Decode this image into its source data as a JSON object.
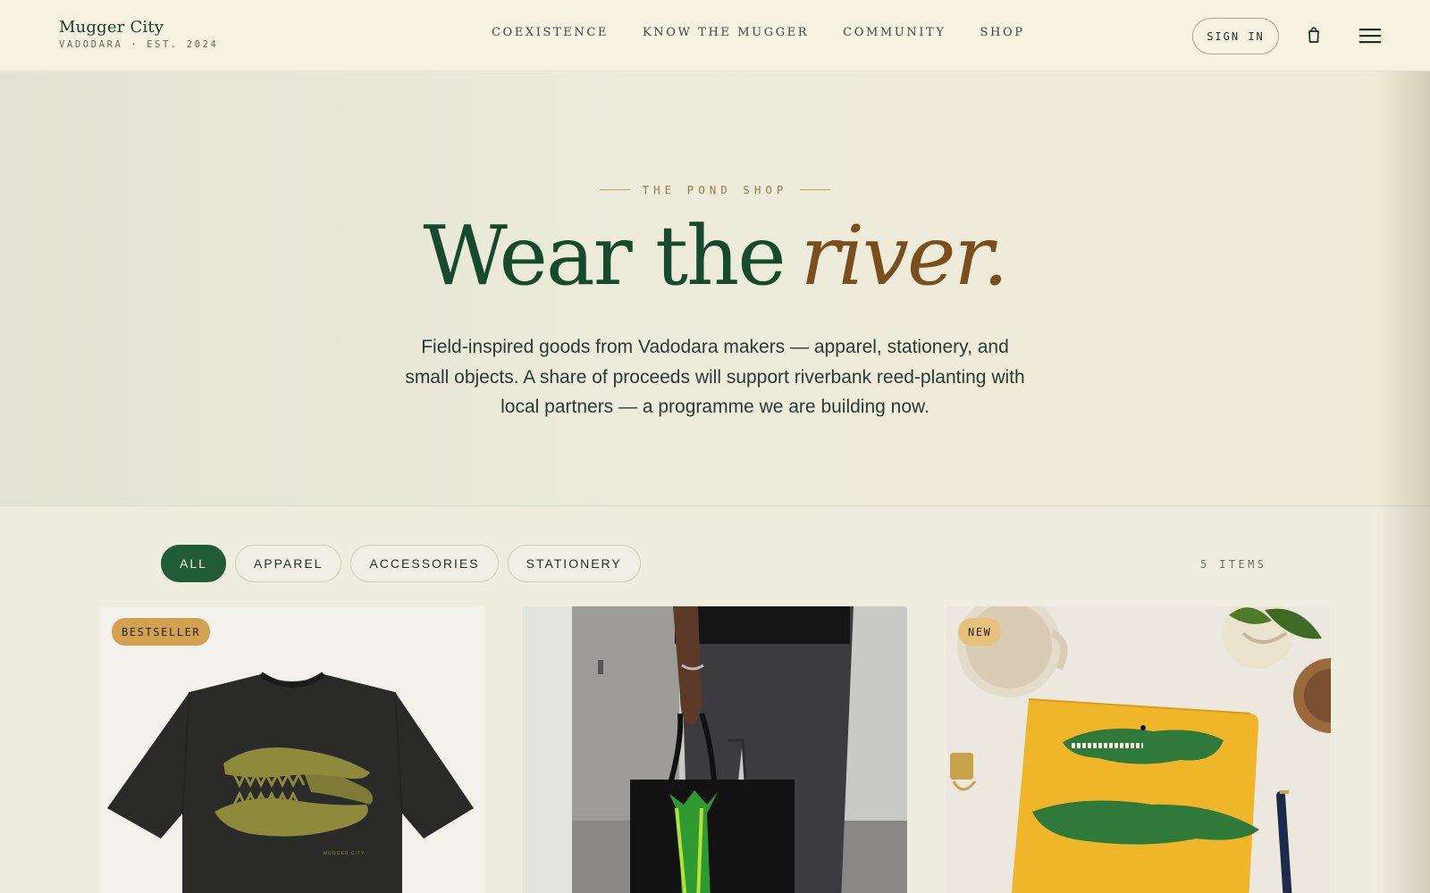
{
  "header": {
    "brand_name": "Mugger City",
    "brand_sub": "VADODARA · EST. 2024",
    "nav": [
      "COEXISTENCE",
      "KNOW THE MUGGER",
      "COMMUNITY",
      "SHOP"
    ],
    "signin_label": "SIGN IN",
    "icons": {
      "bag": "shopping-bag-icon",
      "menu": "hamburger-menu-icon"
    }
  },
  "hero": {
    "eyebrow": "THE POND SHOP",
    "headline_main": "Wear the",
    "headline_accent": "river.",
    "lede": "Field-inspired goods from Vadodara makers — apparel, stationery, and small objects. A share of proceeds will support riverbank reed-planting with local partners — a programme we are building now."
  },
  "filters": {
    "chips": [
      "ALL",
      "APPAREL",
      "ACCESSORIES",
      "STATIONERY"
    ],
    "active": "ALL",
    "count_label": "5 ITEMS"
  },
  "products": [
    {
      "badge": "BESTSELLER",
      "tee_print": "MUGGER CITY"
    },
    {
      "badge": ""
    },
    {
      "badge": "NEW"
    }
  ],
  "colors": {
    "brand_green": "#1f5c37",
    "headline_green": "#164a2d",
    "accent_brown": "#7a4f1d",
    "badge_gold": "#d2a251",
    "cream": "#f6f1e1"
  }
}
